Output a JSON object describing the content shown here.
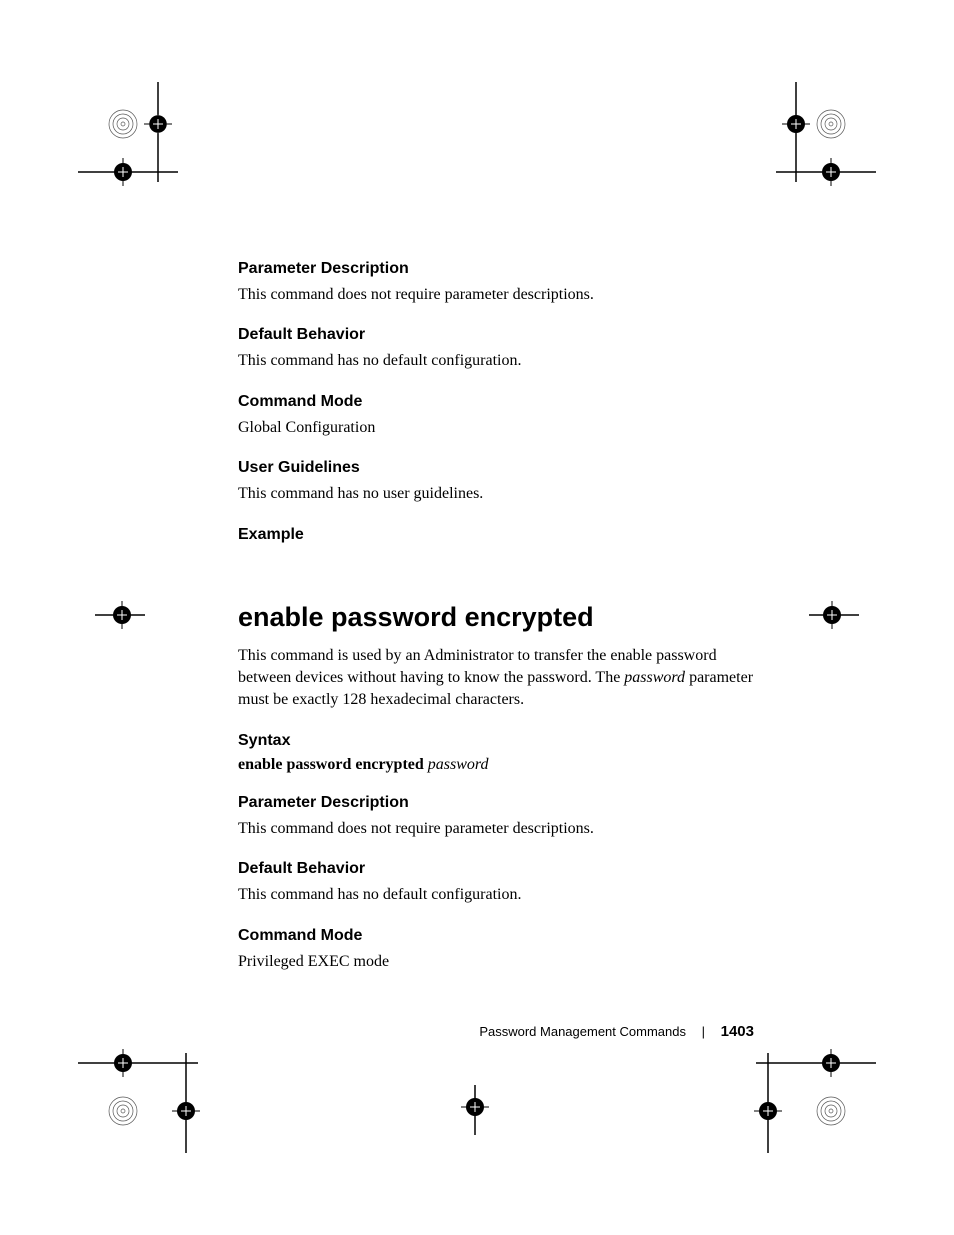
{
  "sections": {
    "param_desc_1": {
      "heading": "Parameter Description",
      "body": "This command does not require parameter descriptions."
    },
    "default_behav_1": {
      "heading": "Default Behavior",
      "body": "This command has no default configuration."
    },
    "command_mode_1": {
      "heading": "Command Mode",
      "body": "Global Configuration"
    },
    "user_guidelines": {
      "heading": "User Guidelines",
      "body": "This command has no user guidelines."
    },
    "example": {
      "heading": "Example"
    },
    "main_title": "enable password encrypted",
    "main_body_1": "This command is used by an Administrator to transfer the enable password between devices without having to know the password. The ",
    "main_body_italic": "password",
    "main_body_2": " parameter must be exactly 128 hexadecimal characters.",
    "syntax": {
      "heading": "Syntax",
      "bold": "enable password encrypted ",
      "italic": "password"
    },
    "param_desc_2": {
      "heading": "Parameter Description",
      "body": "This command does not require parameter descriptions."
    },
    "default_behav_2": {
      "heading": "Default Behavior",
      "body": "This command has no default configuration."
    },
    "command_mode_2": {
      "heading": "Command Mode",
      "body": "Privileged EXEC mode"
    }
  },
  "footer": {
    "section": "Password Management Commands",
    "page": "1403"
  }
}
